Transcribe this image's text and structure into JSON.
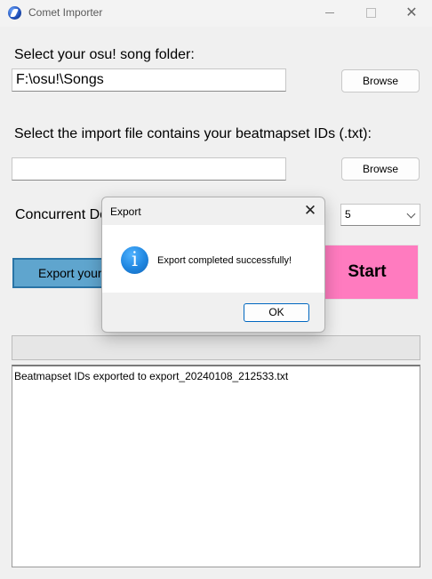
{
  "window": {
    "title": "Comet Importer",
    "icon": "comet-icon"
  },
  "song_folder": {
    "label": "Select your osu! song folder:",
    "value": "F:\\osu!\\Songs",
    "browse_label": "Browse"
  },
  "import_file": {
    "label": "Select the import file contains your beatmapset IDs (.txt):",
    "value": "",
    "browse_label": "Browse"
  },
  "concurrent": {
    "label": "Concurrent Do",
    "selected": "5"
  },
  "actions": {
    "export_label": "Export your",
    "start_label": "Start"
  },
  "log": {
    "lines": [
      "Beatmapset IDs exported to export_20240108_212533.txt"
    ]
  },
  "dialog": {
    "title": "Export",
    "message": "Export completed successfully!",
    "ok_label": "OK",
    "icon": "info-icon"
  },
  "colors": {
    "export_button": "#5fa5ce",
    "start_button": "#ff7bbf",
    "info_icon": "#1f86e0"
  }
}
